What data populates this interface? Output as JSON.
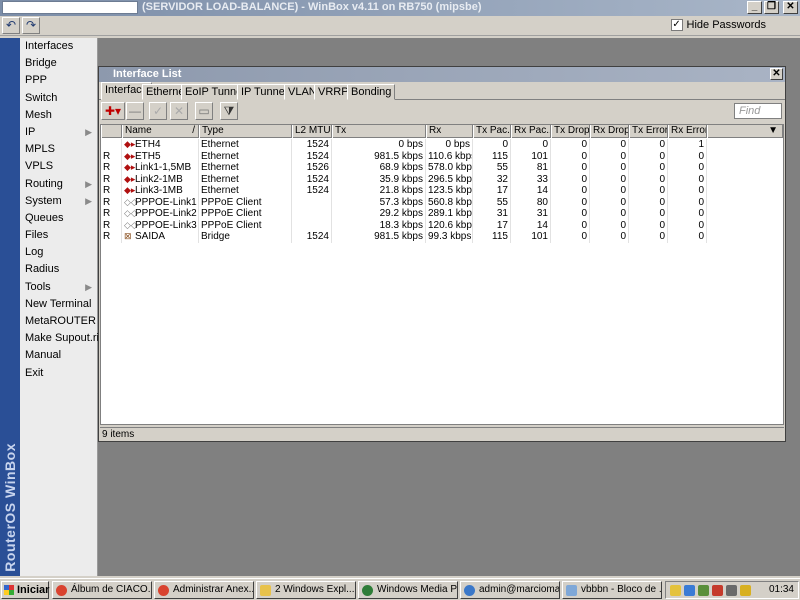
{
  "titlebar": {
    "title": "(SERVIDOR LOAD-BALANCE) - WinBox v4.11 on RB750 (mipsbe)",
    "buttons": [
      "_",
      "❐",
      "✕"
    ]
  },
  "toolbar": {
    "undo_icon": "↶",
    "redo_icon": "↷",
    "hide_passwords_label": "Hide Passwords",
    "hide_passwords_checked": true
  },
  "brand": {
    "text": "RouterOS WinBox"
  },
  "menu": [
    {
      "label": "Interfaces",
      "arrow": ""
    },
    {
      "label": "Bridge",
      "arrow": ""
    },
    {
      "label": "PPP",
      "arrow": ""
    },
    {
      "label": "Switch",
      "arrow": ""
    },
    {
      "label": "Mesh",
      "arrow": ""
    },
    {
      "label": "IP",
      "arrow": "▶"
    },
    {
      "label": "MPLS",
      "arrow": ""
    },
    {
      "label": "VPLS",
      "arrow": ""
    },
    {
      "label": "Routing",
      "arrow": "▶"
    },
    {
      "label": "System",
      "arrow": "▶"
    },
    {
      "label": "Queues",
      "arrow": ""
    },
    {
      "label": "Files",
      "arrow": ""
    },
    {
      "label": "Log",
      "arrow": ""
    },
    {
      "label": "Radius",
      "arrow": ""
    },
    {
      "label": "Tools",
      "arrow": "▶"
    },
    {
      "label": "New Terminal",
      "arrow": ""
    },
    {
      "label": "MetaROUTER",
      "arrow": ""
    },
    {
      "label": "Make Supout.rif",
      "arrow": ""
    },
    {
      "label": "Manual",
      "arrow": ""
    },
    {
      "label": "Exit",
      "arrow": ""
    }
  ],
  "window": {
    "title": "Interface List",
    "close_label": "✕",
    "tabs": [
      "Interface",
      "Ethernet",
      "EoIP Tunnel",
      "IP Tunnel",
      "VLAN",
      "VRRP",
      "Bonding"
    ],
    "active_tab": "Interface",
    "list_toolbar": {
      "add_icon": "✚▾",
      "remove_icon": "—",
      "enable_icon": "✓",
      "disable_icon": "✕",
      "comment_icon": "▭",
      "filter_icon": "⧩"
    },
    "find_placeholder": "Find",
    "columns": [
      "",
      "Name",
      "Type",
      "L2 MTU",
      "Tx",
      "Rx",
      "Tx Pac...",
      "Rx Pac...",
      "Tx Drops",
      "Rx Drops",
      "Tx Errors",
      "Rx Errors"
    ],
    "sort_indicator": "/",
    "rows": [
      {
        "flag": "",
        "icon": "◆▸",
        "name": "ETH4",
        "type": "Ethernet",
        "mtu": "1524",
        "tx": "0 bps",
        "rx": "0 bps",
        "txp": "0",
        "rxp": "0",
        "txd": "0",
        "rxd": "0",
        "txe": "0",
        "rxe": "1"
      },
      {
        "flag": "R",
        "icon": "◆▸",
        "name": "ETH5",
        "type": "Ethernet",
        "mtu": "1524",
        "tx": "981.5 kbps",
        "rx": "110.6 kbps",
        "txp": "115",
        "rxp": "101",
        "txd": "0",
        "rxd": "0",
        "txe": "0",
        "rxe": "0"
      },
      {
        "flag": "R",
        "icon": "◆▸",
        "name": "Link1-1,5MB",
        "type": "Ethernet",
        "mtu": "1526",
        "tx": "68.9 kbps",
        "rx": "578.0 kbps",
        "txp": "55",
        "rxp": "81",
        "txd": "0",
        "rxd": "0",
        "txe": "0",
        "rxe": "0"
      },
      {
        "flag": "R",
        "icon": "◆▸",
        "name": "Link2-1MB",
        "type": "Ethernet",
        "mtu": "1524",
        "tx": "35.9 kbps",
        "rx": "296.5 kbps",
        "txp": "32",
        "rxp": "33",
        "txd": "0",
        "rxd": "0",
        "txe": "0",
        "rxe": "0"
      },
      {
        "flag": "R",
        "icon": "◆▸",
        "name": "Link3-1MB",
        "type": "Ethernet",
        "mtu": "1524",
        "tx": "21.8 kbps",
        "rx": "123.5 kbps",
        "txp": "17",
        "rxp": "14",
        "txd": "0",
        "rxd": "0",
        "txe": "0",
        "rxe": "0"
      },
      {
        "flag": "R",
        "icon": "◇◇",
        "name": "PPPOE-Link1",
        "type": "PPPoE Client",
        "mtu": "",
        "tx": "57.3 kbps",
        "rx": "560.8 kbps",
        "txp": "55",
        "rxp": "80",
        "txd": "0",
        "rxd": "0",
        "txe": "0",
        "rxe": "0"
      },
      {
        "flag": "R",
        "icon": "◇◇",
        "name": "PPPOE-Link2",
        "type": "PPPoE Client",
        "mtu": "",
        "tx": "29.2 kbps",
        "rx": "289.1 kbps",
        "txp": "31",
        "rxp": "31",
        "txd": "0",
        "rxd": "0",
        "txe": "0",
        "rxe": "0"
      },
      {
        "flag": "R",
        "icon": "◇◇",
        "name": "PPPOE-Link3",
        "type": "PPPoE Client",
        "mtu": "",
        "tx": "18.3 kbps",
        "rx": "120.6 kbps",
        "txp": "17",
        "rxp": "14",
        "txd": "0",
        "rxd": "0",
        "txe": "0",
        "rxe": "0"
      },
      {
        "flag": "R",
        "icon": "⊠",
        "name": "SAIDA",
        "type": "Bridge",
        "mtu": "1524",
        "tx": "981.5 kbps",
        "rx": "99.3 kbps",
        "txp": "115",
        "rxp": "101",
        "txd": "0",
        "rxd": "0",
        "txe": "0",
        "rxe": "0"
      }
    ],
    "status": "9 items"
  },
  "taskbar": {
    "start_label": "Iniciar",
    "tasks": [
      "Álbum de CIACO...",
      "Administrar Anex...",
      "2 Windows Expl...",
      "Windows Media Pl...",
      "admin@marcioma...",
      "vbbbn - Bloco de ..."
    ],
    "clock": "01:34"
  }
}
